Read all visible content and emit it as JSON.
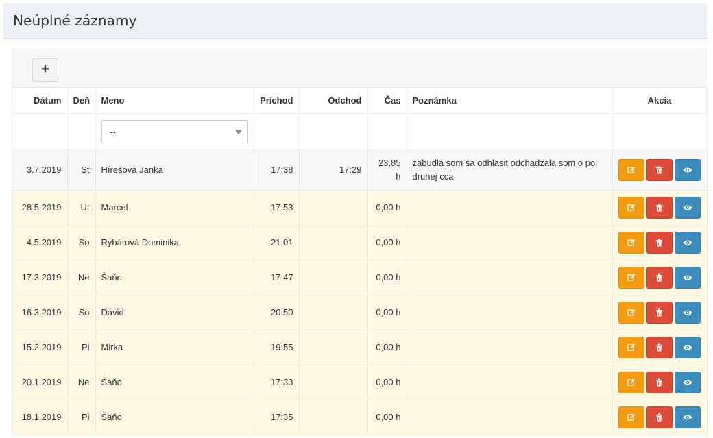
{
  "page_title": "Neúplné záznamy",
  "toolbar": {
    "add_label": "+"
  },
  "table": {
    "headers": {
      "date": "Dátum",
      "day": "Deň",
      "name": "Meno",
      "arrival": "Príchod",
      "departure": "Odchod",
      "time": "Čas",
      "note": "Poznámka",
      "actions": "Akcia"
    },
    "filter": {
      "name_select_value": "--"
    },
    "rows": [
      {
        "date": "3.7.2019",
        "day": "St",
        "name": "Híreš​ová Janka",
        "arrival": "17:38",
        "departure": "17:29",
        "time_line1": "23,85",
        "time_line2": "h",
        "note": "zabudla som sa odhlasit odchadzala som o pol druhej cca"
      },
      {
        "date": "28.5.2019",
        "day": "Ut",
        "name": "Marcel",
        "arrival": "17:53",
        "departure": "",
        "time": "0,00 h",
        "note": ""
      },
      {
        "date": "4.5.2019",
        "day": "So",
        "name": "Rybárová Dominika",
        "arrival": "21:01",
        "departure": "",
        "time": "0,00 h",
        "note": ""
      },
      {
        "date": "17.3.2019",
        "day": "Ne",
        "name": "Šaňo",
        "arrival": "17:47",
        "departure": "",
        "time": "0,00 h",
        "note": ""
      },
      {
        "date": "16.3.2019",
        "day": "So",
        "name": "Dávid",
        "arrival": "20:50",
        "departure": "",
        "time": "0,00 h",
        "note": ""
      },
      {
        "date": "15.2.2019",
        "day": "Pi",
        "name": "Mirka",
        "arrival": "19:55",
        "departure": "",
        "time": "0,00 h",
        "note": ""
      },
      {
        "date": "20.1.2019",
        "day": "Ne",
        "name": "Šaňo",
        "arrival": "17:33",
        "departure": "",
        "time": "0,00 h",
        "note": ""
      },
      {
        "date": "18.1.2019",
        "day": "Pi",
        "name": "Šaňo",
        "arrival": "17:35",
        "departure": "",
        "time": "0,00 h",
        "note": ""
      }
    ],
    "row_actions": [
      "edit-icon",
      "trash-icon",
      "eye-icon"
    ]
  },
  "colors": {
    "edit": "#f39c12",
    "delete": "#dd4b39",
    "view": "#3c8dbc",
    "warning_row": "#fcf8e3",
    "header_bg": "#ecf0f5"
  }
}
